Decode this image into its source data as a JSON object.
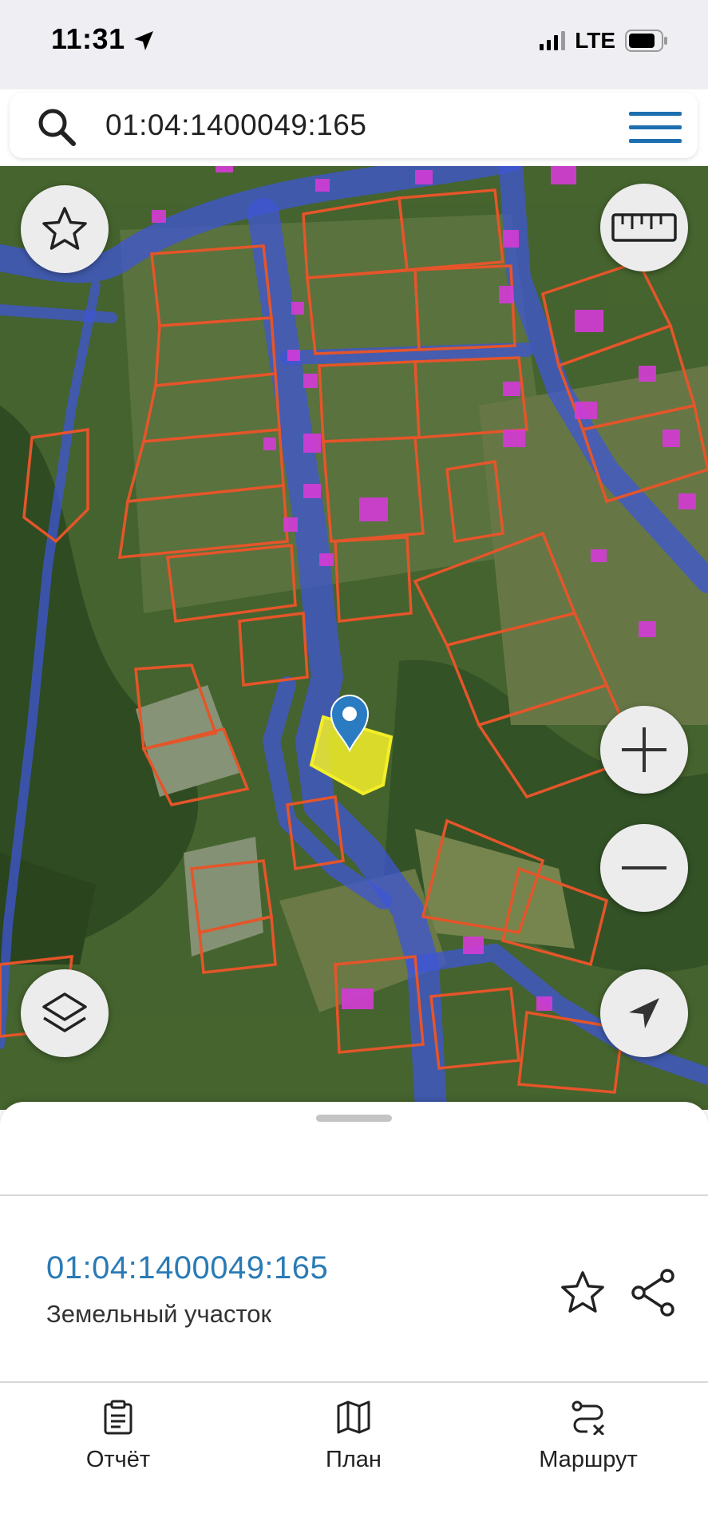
{
  "status_bar": {
    "time": "11:31",
    "network": "LTE"
  },
  "search": {
    "query": "01:04:1400049:165"
  },
  "map": {
    "buttons": [
      "favorite",
      "ruler",
      "zoom-in",
      "zoom-out",
      "layers",
      "locate"
    ],
    "colors": {
      "parcel_border": "#e5552a",
      "road_zone": "#3f56d6",
      "building": "#d43bd6",
      "selected_parcel": "#f3ee28",
      "marker": "#2a7bc2"
    }
  },
  "sheet": {
    "parcel_number": "01:04:1400049:165",
    "parcel_type": "Земельный участок"
  },
  "actions": {
    "report": "Отчёт",
    "plan": "План",
    "route": "Маршрут"
  },
  "colors": {
    "accent": "#2a7bb5",
    "menu_icon": "#1d6fb0"
  }
}
